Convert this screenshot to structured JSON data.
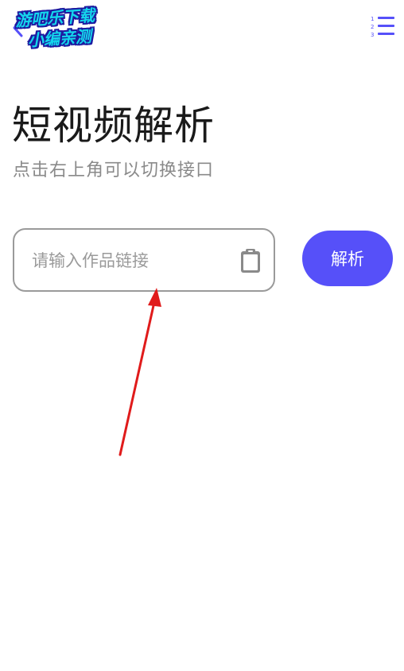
{
  "header": {
    "back_icon": "chevron-left-icon",
    "menu_icon": "numbered-list-icon",
    "menu_numbers": [
      "1",
      "2",
      "3"
    ]
  },
  "watermark": {
    "line1": "游吧乐下载",
    "line2": "小编亲测"
  },
  "page": {
    "title": "短视频解析",
    "subtitle": "点击右上角可以切换接口"
  },
  "link_input": {
    "value": "",
    "placeholder": "请输入作品链接",
    "paste_icon": "clipboard-icon"
  },
  "parse_button": {
    "label": "解析"
  },
  "colors": {
    "accent": "#5650f9",
    "annotation_arrow": "#e01b1b",
    "placeholder": "#9a9a9a",
    "border": "#9a9a9a"
  }
}
